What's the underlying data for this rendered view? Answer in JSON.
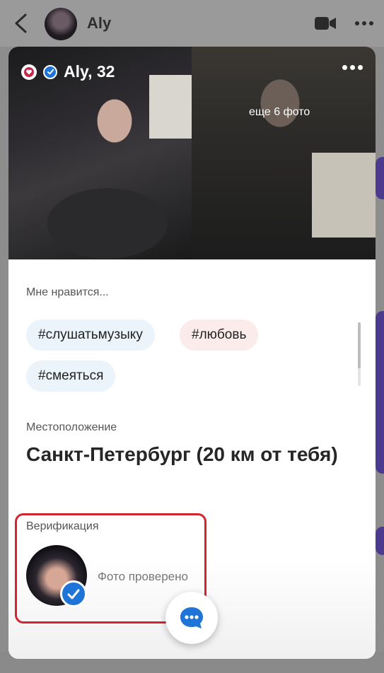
{
  "header": {
    "title": "Aly"
  },
  "profile": {
    "name_age": "Aly, 32",
    "more_photos": "еще 6 фото"
  },
  "interests": {
    "label": "Мне нравится...",
    "tags": [
      "#слушатьмузыку",
      "#любовь",
      "#смеяться"
    ]
  },
  "location": {
    "label": "Местоположение",
    "value": "Санкт-Петербург (20 км от тебя)"
  },
  "verification": {
    "label": "Верификация",
    "status": "Фото проверено"
  },
  "colors": {
    "accent_blue": "#1f74d8",
    "highlight_red": "#d5242f",
    "side_purple": "#4b3a8e"
  },
  "icons": [
    "back-icon",
    "video-call-icon",
    "more-icon",
    "heart-icon",
    "verified-icon",
    "chat-icon"
  ]
}
